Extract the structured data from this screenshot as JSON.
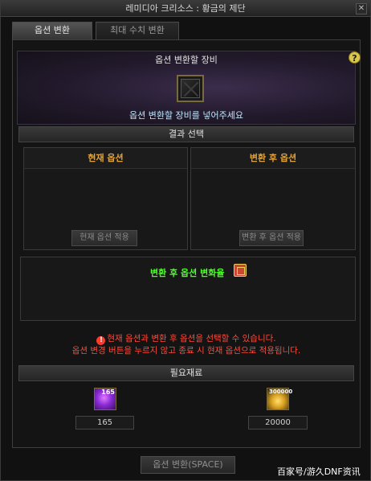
{
  "window": {
    "title": "레미디아 크리소스 : 황금의 제단",
    "close_glyph": "✕"
  },
  "tabs": [
    {
      "label": "옵션 변환",
      "active": true
    },
    {
      "label": "최대 수치 변환",
      "active": false
    }
  ],
  "help_glyph": "?",
  "equip": {
    "title": "옵션 변환할 장비",
    "hint": "옵션 변환할 장비를 넣어주세요"
  },
  "result": {
    "title": "결과 선택",
    "current": {
      "title": "현재 옵션",
      "button": "현재 옵션 적용"
    },
    "after": {
      "title": "변환 후 옵션",
      "button": "변환 후 옵션 적용"
    }
  },
  "notice": "변환 후 옵션 변화율",
  "warnings": [
    "현재 옵션과 변환 후 옵션을 선택할 수 있습니다.",
    "옵션 변경 버튼을 누르지 않고 종료 시 현재 옵션으로 적용됩니다."
  ],
  "warning_glyph": "!",
  "materials": {
    "title": "필요재료",
    "items": [
      {
        "badge": "165",
        "value": "165"
      },
      {
        "badge": "300000",
        "value": "20000"
      }
    ]
  },
  "bottom_button": "옵션 변환(SPACE)",
  "watermark": "百家号/游久DNF资讯",
  "colors": {
    "accent_orange": "#e1a33a",
    "notice_green": "#4cff2a",
    "warning_red": "#ff4a3a"
  }
}
